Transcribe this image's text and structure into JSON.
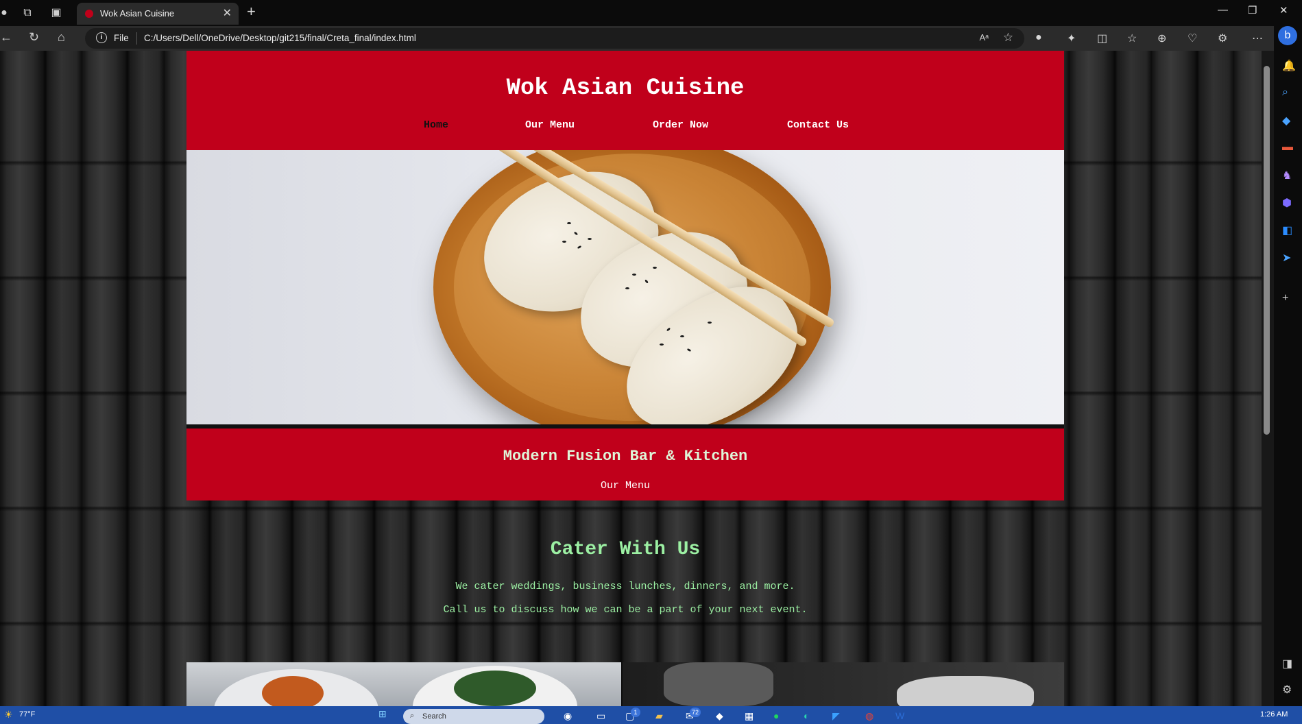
{
  "browser": {
    "tab_title": "Wok Asian Cuisine",
    "address_prefix": "File",
    "url": "C:/Users/Dell/OneDrive/Desktop/git215/final/Creta_final/index.html"
  },
  "site": {
    "title": "Wok Asian Cuisine",
    "nav": [
      "Home",
      "Our Menu",
      "Order Now",
      "Contact Us"
    ],
    "active_nav": "Home",
    "tagline": "Modern Fusion Bar & Kitchen",
    "tagline_link": "Our Menu",
    "cater_heading": "Cater With Us",
    "cater_line1": "We cater weddings, business lunches, dinners, and more.",
    "cater_line2": "Call us to discuss how we can be a part of your next event."
  },
  "taskbar": {
    "weather": "77°F",
    "search_placeholder": "Search",
    "time": "1:26 AM",
    "badge_a": "1",
    "badge_b": "72"
  },
  "colors": {
    "brand_red": "#c0001b",
    "cater_green": "#9cf0a3",
    "tagline_cream": "#dff5d8"
  }
}
